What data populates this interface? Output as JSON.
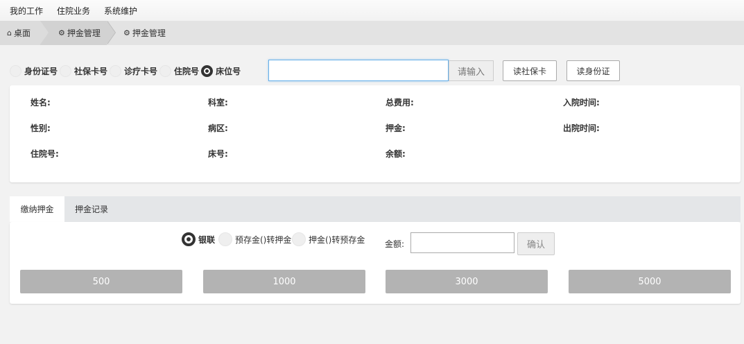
{
  "menu": [
    "我的工作",
    "住院业务",
    "系统维护"
  ],
  "breadcrumb": {
    "home": "桌面",
    "module": "押金管理",
    "current": "押金管理"
  },
  "search": {
    "options": [
      "身份证号",
      "社保卡号",
      "诊疗卡号",
      "住院号",
      "床位号"
    ],
    "selected": "床位号",
    "value": "",
    "addon": "请输入",
    "read_social_card": "读社保卡",
    "read_id_card": "读身份证"
  },
  "patient_fields": {
    "name": "姓名:",
    "dept": "科室:",
    "total_cost": "总费用:",
    "admit_time": "入院时间:",
    "gender": "性别:",
    "ward": "病区:",
    "deposit": "押金:",
    "discharge_time": "出院时间:",
    "inpatient_no": "住院号:",
    "bed_no": "床号:",
    "balance": "余额:"
  },
  "tabs": {
    "pay": "缴纳押金",
    "records": "押金记录",
    "active": "缴纳押金"
  },
  "payment": {
    "methods": [
      "银联",
      "预存金()转押金",
      "押金()转预存金"
    ],
    "selected": "银联",
    "amount_label": "金额:",
    "amount_value": "",
    "confirm": "确认",
    "quick_amounts": [
      "500",
      "1000",
      "3000",
      "5000"
    ]
  },
  "colors": {
    "accent_focus": "#66afe9",
    "quick_button": "#b3b3b3"
  }
}
